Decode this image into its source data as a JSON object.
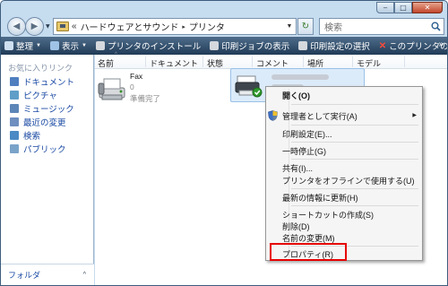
{
  "window": {
    "controls": {
      "minimize": "‒",
      "maximize": "□",
      "close": "✕"
    }
  },
  "nav": {
    "back": "◀",
    "forward": "▶",
    "dropdown": "▼"
  },
  "address": {
    "chevron": "«",
    "crumbs": [
      "ハードウェアとサウンド",
      "プリンタ"
    ],
    "separator": "▸",
    "dropdown": "▼"
  },
  "refresh_glyph": "↻",
  "search": {
    "placeholder": "検索"
  },
  "toolbar": {
    "organize": "整理",
    "views": "表示",
    "add_printer": "プリンタのインストール",
    "see_queue": "印刷ジョブの表示",
    "select_prefs": "印刷設定の選択",
    "delete_printer": "このプリンタの削除",
    "arrow": "▼",
    "more": "»"
  },
  "left_pane": {
    "header": "お気に入りリンク",
    "items": [
      {
        "label": "ドキュメント",
        "icon": "documents-icon",
        "color": "#4f7fbf"
      },
      {
        "label": "ピクチャ",
        "icon": "pictures-icon",
        "color": "#5f9ec8"
      },
      {
        "label": "ミュージック",
        "icon": "music-icon",
        "color": "#5d86b8"
      },
      {
        "label": "最近の変更",
        "icon": "recent-changes-icon",
        "color": "#6e8fbf"
      },
      {
        "label": "検索",
        "icon": "search-folder-icon",
        "color": "#4b8ac4"
      },
      {
        "label": "パブリック",
        "icon": "public-icon",
        "color": "#7aa3c9"
      }
    ],
    "folders": "フォルダ",
    "folders_caret": "^"
  },
  "columns": [
    "名前",
    "ドキュメント",
    "状態",
    "コメント",
    "場所",
    "モデル"
  ],
  "sort_arrow": "^",
  "fax": {
    "name": "Fax",
    "documents": "0",
    "status": "準備完了"
  },
  "context_menu": {
    "items": {
      "open": "開く(O)",
      "run_as_admin": "管理者として実行(A)",
      "printing_prefs": "印刷設定(E)...",
      "pause": "一時停止(G)",
      "sharing": "共有(I)...",
      "use_offline": "プリンタをオフラインで使用する(U)",
      "refresh": "最新の情報に更新(H)",
      "create_shortcut": "ショートカットの作成(S)",
      "delete": "削除(D)",
      "rename": "名前の変更(M)",
      "properties": "プロパティ(R)"
    },
    "submenu_arrow": "▶"
  },
  "colors": {
    "toolbar_top": "#4f6d8b",
    "toolbar_bottom": "#203b57",
    "selection": "#dcebf9",
    "highlight_box": "#e60000",
    "link": "#1a4aa3"
  }
}
